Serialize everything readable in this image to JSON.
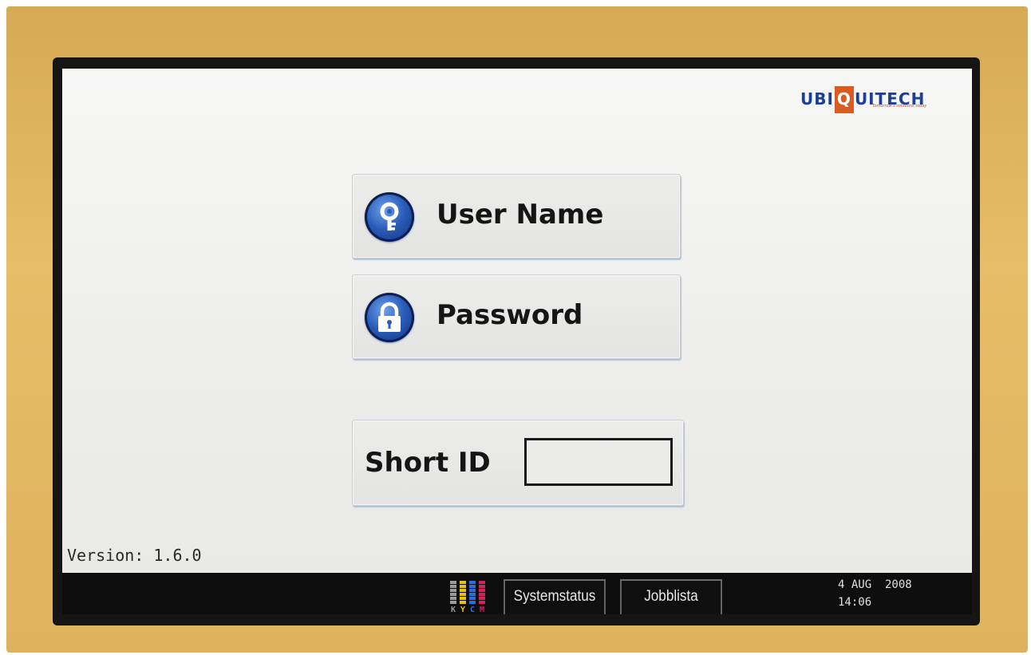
{
  "logo": {
    "text_before": "UBI",
    "text_q": "Q",
    "text_after": "UITECH",
    "tagline": "Tomorrow's solutions today",
    "colors": {
      "text": "#1f3f93",
      "q_box": "#d95c22"
    }
  },
  "login": {
    "username_label": "User Name",
    "username_icon": "key-icon",
    "password_label": "Password",
    "password_icon": "padlock-icon",
    "short_id_label": "Short ID",
    "short_id_value": ""
  },
  "version": "Version: 1.6.0",
  "taskbar": {
    "toner": [
      "K",
      "Y",
      "C",
      "M"
    ],
    "toner_colors": {
      "K": "#9a9a9a",
      "Y": "#e8c21c",
      "C": "#2c6fd8",
      "M": "#d0245c"
    },
    "systemstatus_label": "Systemstatus",
    "jobblista_label": "Jobblista",
    "date": "4 AUG  2008",
    "time": "14:06"
  },
  "colors": {
    "screen_bg": "#f2f2f1",
    "button_face": "#e8e8e7",
    "icon_blue": "#2a5db8",
    "taskbar_bg": "#0e0e0e"
  }
}
